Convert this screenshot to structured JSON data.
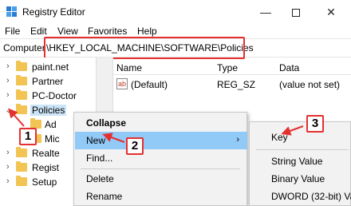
{
  "window": {
    "title": "Registry Editor"
  },
  "menubar": [
    "File",
    "Edit",
    "View",
    "Favorites",
    "Help"
  ],
  "address": {
    "prefix": "Computer",
    "path": "\\HKEY_LOCAL_MACHINE\\SOFTWARE\\Policies"
  },
  "tree": {
    "items": [
      {
        "label": "paint.net"
      },
      {
        "label": "Partner"
      },
      {
        "label": "PC-Doctor"
      },
      {
        "label": "Policies"
      },
      {
        "label": "Ad"
      },
      {
        "label": "Mic"
      },
      {
        "label": "Realte"
      },
      {
        "label": "Regist"
      },
      {
        "label": "Setup"
      }
    ]
  },
  "list": {
    "columns": [
      "Name",
      "Type",
      "Data"
    ],
    "rows": [
      {
        "name": "(Default)",
        "type": "REG_SZ",
        "data": "(value not set)",
        "icon_text": "ab"
      }
    ]
  },
  "context_menu": {
    "items": [
      "Collapse",
      "New",
      "Find...",
      "Delete",
      "Rename"
    ]
  },
  "submenu": {
    "items": [
      "Key",
      "String Value",
      "Binary Value",
      "DWORD (32-bit) Va"
    ]
  },
  "callouts": [
    "1",
    "2",
    "3"
  ],
  "colors": {
    "callout_border": "#e53030",
    "hover": "#91c9f7",
    "selection": "#cce4f7",
    "folder": "#f2c453"
  }
}
